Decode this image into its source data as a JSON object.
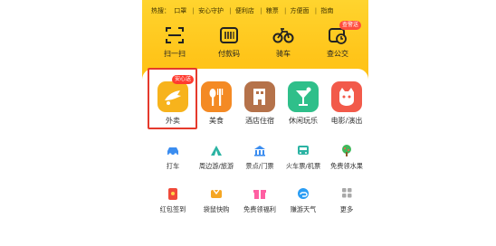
{
  "hotline": {
    "items": [
      "热搜：",
      "口罩",
      "|",
      "安心守护",
      "|",
      "便利店",
      "|",
      "粮票",
      "|",
      "方便面",
      "|",
      "指南"
    ]
  },
  "quick_actions": [
    {
      "label": "扫一扫",
      "icon": "scan-icon"
    },
    {
      "label": "付款码",
      "icon": "barcode-icon"
    },
    {
      "label": "骑车",
      "icon": "bike-icon"
    },
    {
      "label": "查公交",
      "icon": "bus-icon",
      "badge": "查警送"
    }
  ],
  "services_big": [
    {
      "label": "外卖",
      "icon": "delivery-icon",
      "badge": "安心送",
      "color": "#f7b31c"
    },
    {
      "label": "美食",
      "icon": "utensils-icon",
      "color": "#f48a24"
    },
    {
      "label": "酒店住宿",
      "icon": "hotel-icon",
      "color": "#b5724a"
    },
    {
      "label": "休闲玩乐",
      "icon": "cocktail-icon",
      "color": "#2fbf8a"
    },
    {
      "label": "电影/演出",
      "icon": "cat-icon",
      "color": "#f25a4a"
    }
  ],
  "services_small_row1": [
    {
      "label": "打车",
      "icon": "car-icon"
    },
    {
      "label": "周边游/旅游",
      "icon": "tent-icon"
    },
    {
      "label": "景点/门票",
      "icon": "landmark-icon"
    },
    {
      "label": "火车票/机票",
      "icon": "train-icon"
    },
    {
      "label": "免费领水果",
      "icon": "tree-icon"
    }
  ],
  "services_small_row2": [
    {
      "label": "红包签到",
      "icon": "redpacket-icon"
    },
    {
      "label": "袋鼠快购",
      "icon": "cart-icon"
    },
    {
      "label": "免费领福利",
      "icon": "gift-icon"
    },
    {
      "label": "赚游天气",
      "icon": "weather-icon"
    },
    {
      "label": "更多",
      "icon": "grid-icon"
    }
  ],
  "colors": {
    "brand_yellow": "#ffc51a",
    "highlight_red": "#e53a2c"
  }
}
